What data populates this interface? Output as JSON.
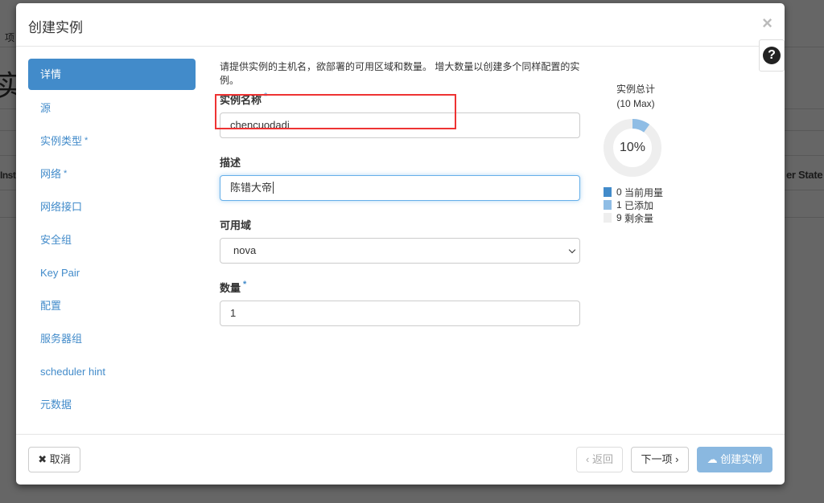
{
  "background": {
    "crumb": "项",
    "heading": "实",
    "col_left": "Inst",
    "col_right": "er State"
  },
  "modal": {
    "title": "创建实例",
    "close": "×",
    "help": "?"
  },
  "nav": [
    {
      "label": "详情",
      "required": false
    },
    {
      "label": "源",
      "required": false
    },
    {
      "label": "实例类型",
      "required": true
    },
    {
      "label": "网络",
      "required": true
    },
    {
      "label": "网络接口",
      "required": false
    },
    {
      "label": "安全组",
      "required": false
    },
    {
      "label": "Key Pair",
      "required": false
    },
    {
      "label": "配置",
      "required": false
    },
    {
      "label": "服务器组",
      "required": false
    },
    {
      "label": "scheduler hint",
      "required": false
    },
    {
      "label": "元数据",
      "required": false
    }
  ],
  "form": {
    "intro": "请提供实例的主机名，欲部署的可用区域和数量。 增大数量以创建多个同样配置的实例。",
    "name_label": "实例名称",
    "name_value": "chencuodadi",
    "desc_label": "描述",
    "desc_value": "陈错大帝",
    "az_label": "可用域",
    "az_value": "nova",
    "count_label": "数量",
    "count_value": "1",
    "required_mark": "*"
  },
  "quota": {
    "title": "实例总计",
    "max": "(10 Max)",
    "percent": "10%",
    "fraction": 0.1,
    "legend": [
      {
        "value": "0",
        "label": "当前用量",
        "color": "#428bca"
      },
      {
        "value": "1",
        "label": "已添加",
        "color": "#8fbde5"
      },
      {
        "value": "9",
        "label": "剩余量",
        "color": "#eeeeee"
      }
    ]
  },
  "footer": {
    "cancel": "取消",
    "back": "‹ 返回",
    "next": "下一项 ›",
    "create": "创建实例"
  }
}
